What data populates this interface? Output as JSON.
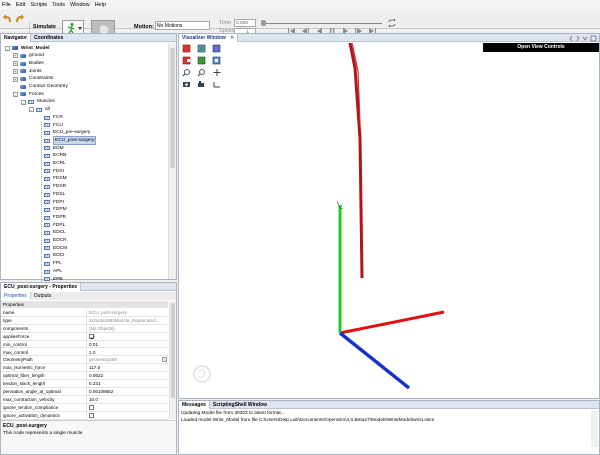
{
  "menu": [
    "File",
    "Edit",
    "Scripts",
    "Tools",
    "Window",
    "Help"
  ],
  "toolbar": {
    "simulate_label": "Simulate",
    "motion_label": "Motion:",
    "motion_value": "No Motions",
    "time_label": "Time",
    "time_value": "0.000",
    "speed_label": "Speed",
    "speed_value": "1"
  },
  "navigator": {
    "tab_navigator": "Navigator",
    "tab_coordinates": "Coordinates",
    "model_name": "Wrist_Model",
    "top_items": [
      "ground",
      "Bodies",
      "Joints",
      "Constraints",
      "Contact Geometry",
      "Forces"
    ],
    "muscles_label": "Muscles",
    "all_label": "all",
    "muscle_items": [
      "FCR",
      "FCU",
      "ECU_pre-surgery",
      "ECU_post-surgery",
      "EDM",
      "ECRB",
      "ECRL",
      "FDSI",
      "FDSM",
      "FDSR",
      "FDSL",
      "FDPI",
      "FDPM",
      "FDPR",
      "FDPL",
      "EDCL",
      "EDCR",
      "EDCM",
      "EDCI",
      "FPL",
      "APL",
      "EPB"
    ],
    "selected_item": "ECU_post-surgery"
  },
  "properties": {
    "title": "ECU_post-surgery - Properties",
    "tab_properties": "Properties",
    "tab_outputs": "Outputs",
    "section_label": "Properties",
    "rows": [
      {
        "k": "name",
        "v": "ECU_post-surgery",
        "grey": true
      },
      {
        "k": "type",
        "v": "Schutte1993Muscle_Deprecated",
        "grey": true
      },
      {
        "k": "components",
        "v": "(No Objects)",
        "grey": true
      },
      {
        "k": "appliesForce",
        "v": "",
        "check": true,
        "checked": true
      },
      {
        "k": "min_control",
        "v": "0.01"
      },
      {
        "k": "max_control",
        "v": "1.0"
      },
      {
        "k": "GeometryPath",
        "v": "geometrypath",
        "grey": true
      },
      {
        "k": "max_isometric_force",
        "v": "117.0"
      },
      {
        "k": "optimal_fiber_length",
        "v": "0.0622"
      },
      {
        "k": "tendon_slack_length",
        "v": "0.231"
      },
      {
        "k": "pennation_angle_at_optimal",
        "v": "0.06108652"
      },
      {
        "k": "max_contraction_velocity",
        "v": "10.0"
      },
      {
        "k": "ignore_tendon_compliance",
        "v": "",
        "check": true,
        "checked": false
      },
      {
        "k": "ignore_activation_dynamics",
        "v": "",
        "check": true,
        "checked": false
      }
    ],
    "desc_title": "ECU_post-surgery",
    "desc_text": "This node represents a single muscle"
  },
  "visualizer": {
    "tab_label": "Visualizer Window",
    "open_view_controls": "Open View Controls"
  },
  "messages": {
    "tab_messages": "Messages",
    "tab_scripting": "ScriptingShell Window",
    "lines": [
      "Updating Model file from 30303 to latest format...",
      "Loaded model Wrist_Model from file C:\\Users\\Delp Lab\\Documents\\OpenSim\\4.0.Beta27\\Models\\WristModel\\wrist.osim"
    ]
  },
  "colors": {
    "x_axis": "#dd1111",
    "y_axis": "#22cc22",
    "z_axis": "#1133cc",
    "muscle": "#b3141a",
    "selected_bg": "#c9d8ef"
  }
}
